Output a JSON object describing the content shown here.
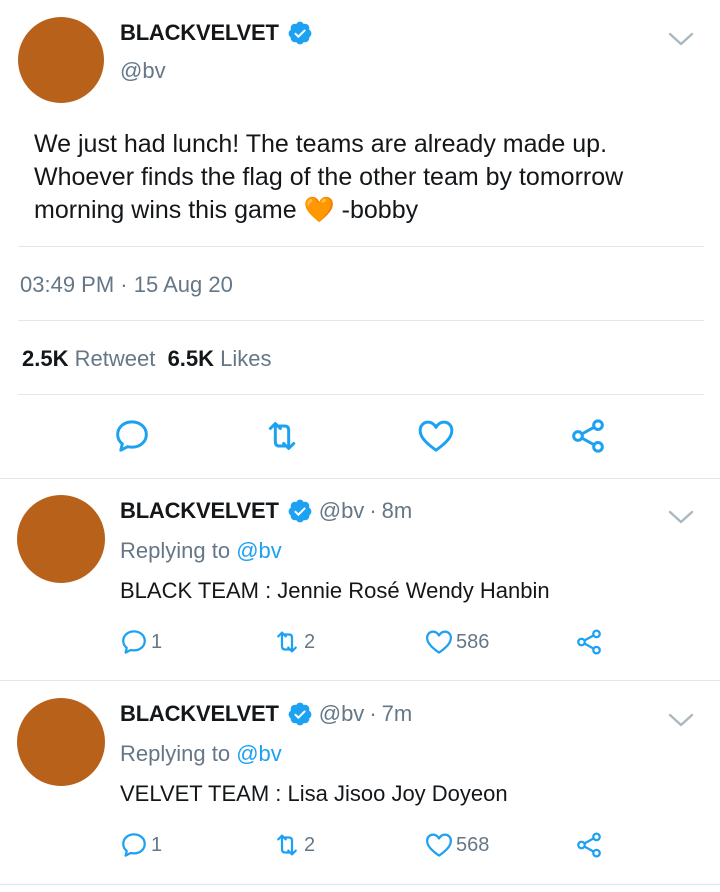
{
  "main_tweet": {
    "display_name": "BLACKVELVET",
    "handle": "@bv",
    "text": "We just had lunch! The teams are already made up. Whoever finds the flag of the other team by tomorrow morning wins this game",
    "emoji": "🧡",
    "text_suffix": " -bobby",
    "timestamp": "03:49 PM · 15 Aug 20",
    "retweet_count": "2.5K",
    "retweet_label": "Retweet",
    "likes_count": "6.5K",
    "likes_label": "Likes"
  },
  "replies": [
    {
      "display_name": "BLACKVELVET",
      "handle": "@bv",
      "time": "8m",
      "replying_label": "Replying to",
      "replying_to": "@bv",
      "text": "BLACK TEAM : Jennie Rosé Wendy Hanbin",
      "reply_count": "1",
      "retweet_count": "2",
      "like_count": "586"
    },
    {
      "display_name": "BLACKVELVET",
      "handle": "@bv",
      "time": "7m",
      "replying_label": "Replying to",
      "replying_to": "@bv",
      "text": "VELVET TEAM : Lisa Jisoo Joy Doyeon",
      "reply_count": "1",
      "retweet_count": "2",
      "like_count": "568"
    }
  ],
  "colors": {
    "avatar": "#b8611a",
    "verified": "#1da1f2",
    "secondary_text": "#657786",
    "link": "#1da1f2",
    "icon": "#1da1f2"
  },
  "icons": {
    "verified": "verified-badge-icon",
    "chevron": "chevron-down-icon",
    "reply": "reply-icon",
    "retweet": "retweet-icon",
    "like": "heart-icon",
    "share": "share-icon"
  }
}
